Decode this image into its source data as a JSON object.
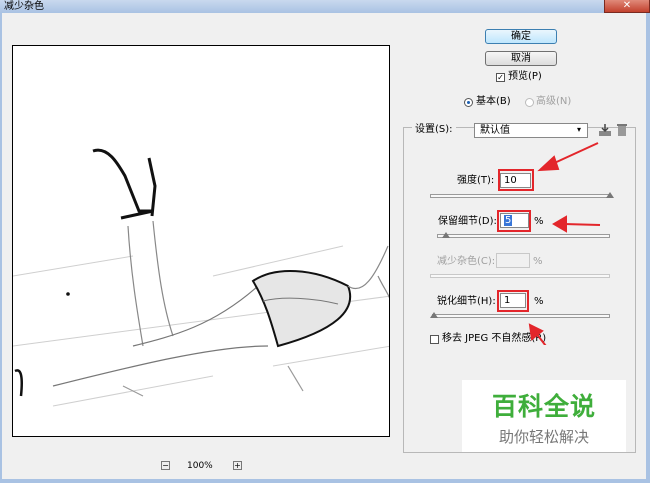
{
  "window": {
    "title": "减少杂色",
    "close_glyph": "✕"
  },
  "buttons": {
    "ok": "确定",
    "cancel": "取消"
  },
  "preview_check": {
    "label": "预览(P)",
    "checked": true
  },
  "mode": {
    "basic": "基本(B)",
    "advanced": "高级(N)",
    "selected": "basic"
  },
  "settings": {
    "label": "设置(S):",
    "value": "默认值"
  },
  "strength": {
    "label": "强度(T):",
    "value": "10",
    "level": 1.0
  },
  "preserve": {
    "label": "保留细节(D):",
    "value": "5",
    "unit": "%",
    "level": 0.05
  },
  "reduce_color": {
    "label": "减少杂色(C):",
    "value": "",
    "unit": "%",
    "disabled": true
  },
  "sharpen": {
    "label": "锐化细节(H):",
    "value": "1",
    "unit": "%",
    "level": 0.01
  },
  "jpeg": {
    "label": "移去 JPEG 不自然感(R)",
    "checked": false
  },
  "zoom": {
    "value": "100%",
    "minus": "−",
    "plus": "+"
  },
  "watermark": {
    "main": "百科全说",
    "sub": "助你轻松解决"
  },
  "colors": {
    "accent_red": "#e3262b",
    "watermark_green": "#3fae3b"
  }
}
